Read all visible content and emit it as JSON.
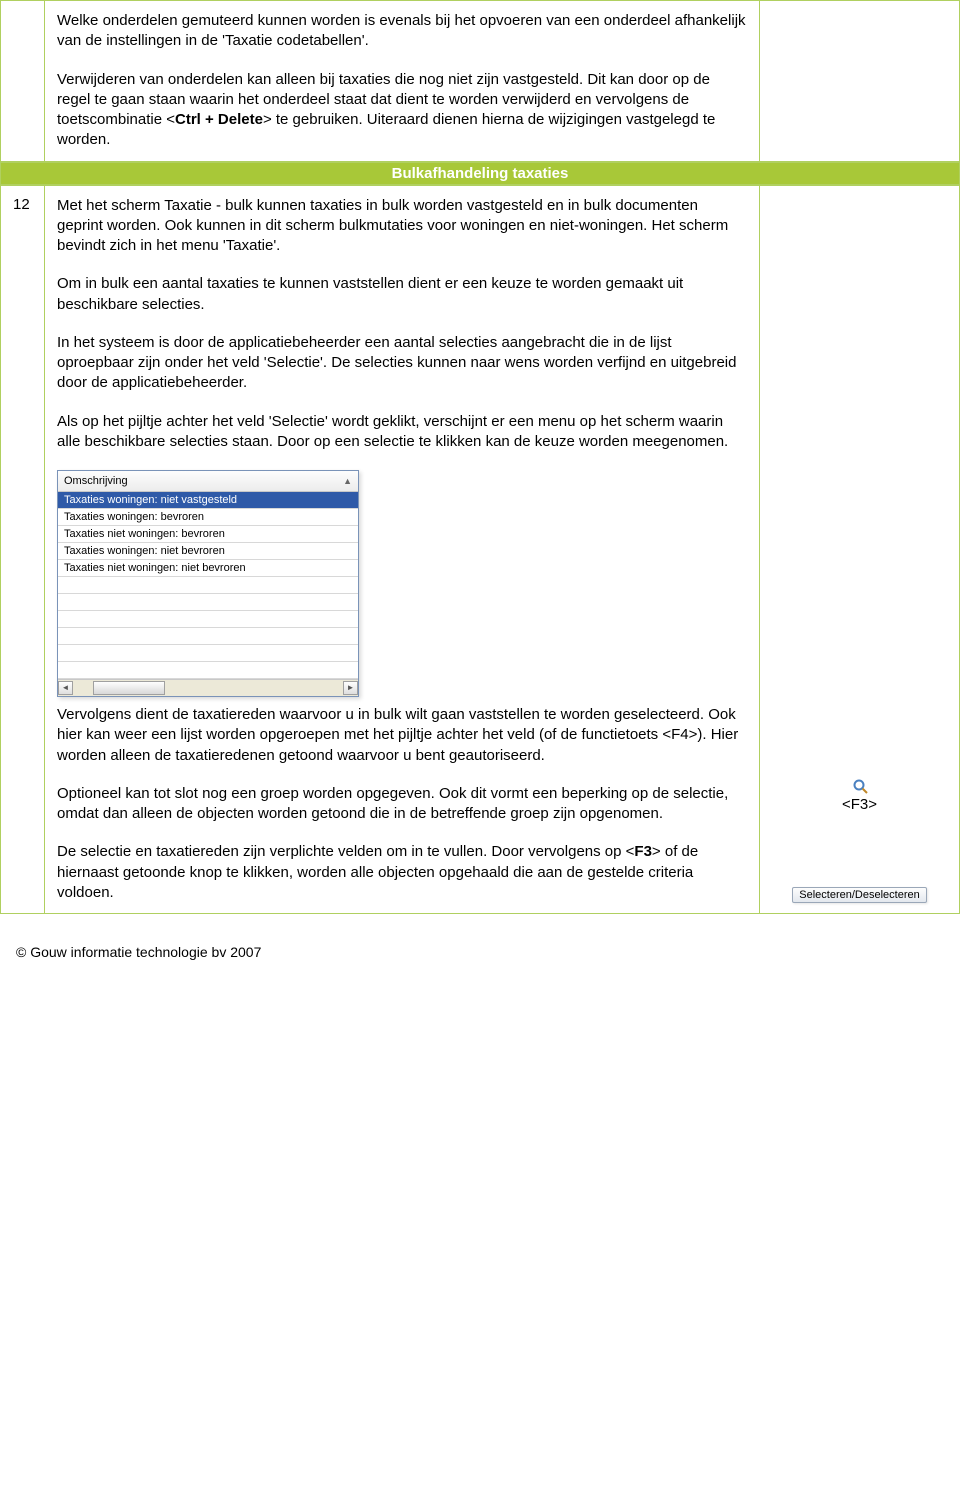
{
  "row1": {
    "p1": "Welke onderdelen gemuteerd kunnen worden is evenals bij het opvoeren van een onderdeel afhankelijk van de instellingen in de 'Taxatie codetabellen'.",
    "p2a": "Verwijderen van onderdelen kan alleen bij taxaties die nog niet zijn vastgesteld. Dit kan door op de regel te gaan staan waarin het onderdeel staat dat dient te worden verwijderd en vervolgens de toetscombinatie <",
    "p2b": "Ctrl + Delete",
    "p2c": "> te gebruiken. Uiteraard dienen hierna de wijzigingen vastgelegd te worden."
  },
  "section_header": "Bulkafhandeling taxaties",
  "row2": {
    "num": "12",
    "p1": "Met het scherm Taxatie - bulk kunnen taxaties in bulk worden vastgesteld en in bulk documenten geprint worden. Ook kunnen in dit scherm bulkmutaties voor woningen en niet-woningen. Het scherm bevindt zich in het menu 'Taxatie'.",
    "p2": "Om in bulk een aantal taxaties te kunnen vaststellen dient er een keuze te worden gemaakt uit beschikbare selecties.",
    "p3": "In het systeem is door de applicatiebeheerder een aantal selecties aangebracht die in de lijst oproepbaar zijn onder het veld 'Selectie'. De selecties kunnen naar wens worden verfijnd en uitgebreid door de applicatiebeheerder.",
    "p4": "Als op het pijltje achter het veld 'Selectie' wordt geklikt, verschijnt er een menu op het scherm waarin alle beschikbare selecties staan. Door op een selectie te klikken kan de keuze worden meegenomen.",
    "listbox": {
      "header": "Omschrijving",
      "items": [
        "Taxaties woningen: niet vastgesteld",
        "Taxaties woningen: bevroren",
        "Taxaties niet woningen: bevroren",
        "Taxaties woningen: niet bevroren",
        "Taxaties niet woningen: niet bevroren"
      ]
    },
    "p5": "Vervolgens dient de taxatiereden waarvoor u in bulk wilt gaan vaststellen te worden geselecteerd. Ook hier kan weer een lijst worden opgeroepen met het pijltje achter het veld (of de functietoets <F4>). Hier worden alleen de taxatieredenen getoond waarvoor u bent geautoriseerd.",
    "p6": "Optioneel kan tot slot nog een groep worden opgegeven. Ook dit vormt een beperking op de selectie, omdat dan alleen de objecten worden getoond die in de betreffende groep zijn opgenomen.",
    "p7a": "De selectie en taxatiereden zijn verplichte velden om in te vullen. Door vervolgens op <",
    "p7b": "F3",
    "p7c": "> of de hiernaast getoonde knop te klikken, worden alle objecten opgehaald die aan de gestelde criteria voldoen."
  },
  "side": {
    "shortcut": "<F3>",
    "button_label": "Selecteren/Deselecteren"
  },
  "footer": "© Gouw informatie technologie bv 2007"
}
